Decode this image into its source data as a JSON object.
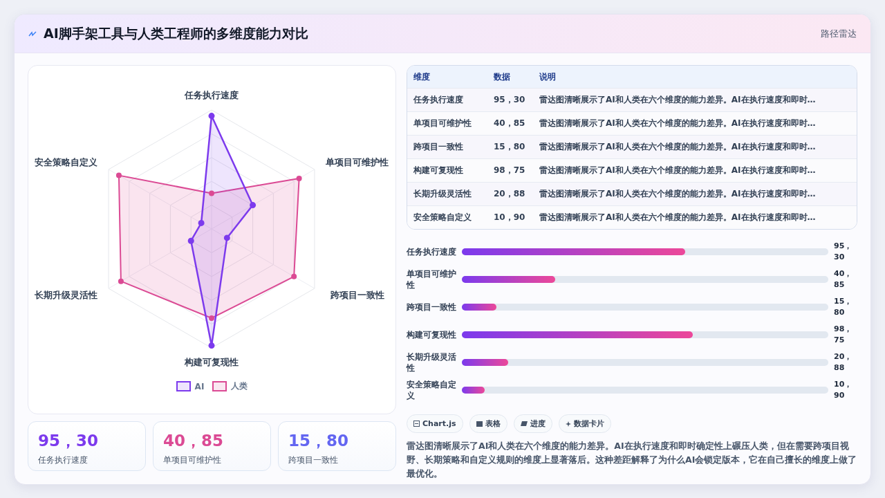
{
  "header": {
    "title": "AI脚手架工具与人类工程师的多维度能力对比",
    "badge": "路径雷达"
  },
  "radar": {
    "axes": [
      "任务执行速度",
      "安全策略自定义",
      "单项目可维护性",
      "长期升级灵活性",
      "跨项目一致性",
      "构建可复现性"
    ],
    "legend": [
      {
        "label": "AI",
        "color": "#7c3aed"
      },
      {
        "label": "人类",
        "color": "#db4a94"
      }
    ]
  },
  "stats": [
    {
      "value": "95，30",
      "label": "任务执行速度",
      "color": "#7c3aed"
    },
    {
      "value": "40，85",
      "label": "单项目可维护性",
      "color": "#db4a94"
    },
    {
      "value": "15，80",
      "label": "跨项目一致性",
      "color": "#6366f1"
    }
  ],
  "table": {
    "columns": [
      "维度",
      "数据",
      "说明"
    ],
    "rows": [
      [
        "任务执行速度",
        "95，30",
        "雷达图清晰展示了AI和人类在六个维度的能力差异。AI在执行速度和即时…"
      ],
      [
        "单项目可维护性",
        "40，85",
        "雷达图清晰展示了AI和人类在六个维度的能力差异。AI在执行速度和即时…"
      ],
      [
        "跨项目一致性",
        "15，80",
        "雷达图清晰展示了AI和人类在六个维度的能力差异。AI在执行速度和即时…"
      ],
      [
        "构建可复现性",
        "98，75",
        "雷达图清晰展示了AI和人类在六个维度的能力差异。AI在执行速度和即时…"
      ],
      [
        "长期升级灵活性",
        "20，88",
        "雷达图清晰展示了AI和人类在六个维度的能力差异。AI在执行速度和即时…"
      ],
      [
        "安全策略自定义",
        "10，90",
        "雷达图清晰展示了AI和人类在六个维度的能力差异。AI在执行速度和即时…"
      ]
    ]
  },
  "bars": [
    {
      "label": "任务执行速度",
      "value": "95，30",
      "level": 0.61
    },
    {
      "label": "单项目可维护性",
      "value": "40，85",
      "level": 0.255
    },
    {
      "label": "跨项目一致性",
      "value": "15，80",
      "level": 0.095
    },
    {
      "label": "构建可复现性",
      "value": "98，75",
      "level": 0.63
    },
    {
      "label": "长期升级灵活性",
      "value": "20，88",
      "level": 0.127
    },
    {
      "label": "安全策略自定义",
      "value": "10，90",
      "level": 0.063
    }
  ],
  "chips": [
    {
      "kind": "chart",
      "label": "Chart.js"
    },
    {
      "kind": "table",
      "label": "表格"
    },
    {
      "kind": "progress",
      "label": "进度"
    },
    {
      "kind": "cards",
      "label": "数据卡片"
    }
  ],
  "summary": "雷达图清晰展示了AI和人类在六个维度的能力差异。AI在执行速度和即时确定性上碾压人类，但在需要跨项目视野、长期策略和自定义规则的维度上显著落后。这种差距解释了为什么AI会锁定版本，它在自己擅长的维度上做了最优化。"
}
